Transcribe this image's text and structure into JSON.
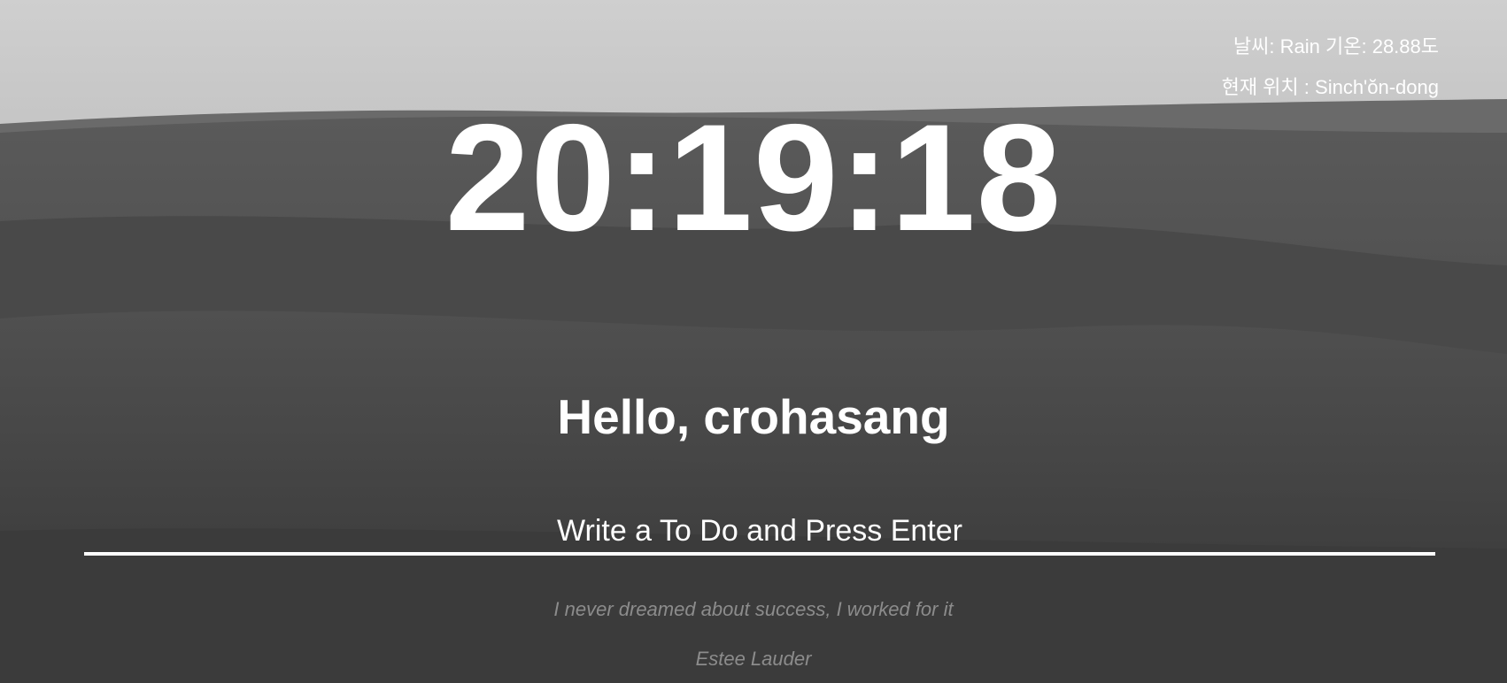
{
  "background": {
    "description_icon": "desert-dunes-image",
    "sky_color": "#cfcfcf",
    "dune_color": "#3d3d3d"
  },
  "weather": {
    "label": "날씨:",
    "condition": "Rain",
    "temp_label": "기온:",
    "temperature": "28.88도"
  },
  "location": {
    "label": "현재 위치 :",
    "name": "Sinch'ŏn-dong"
  },
  "clock": {
    "time": "20:19:18"
  },
  "greeting": {
    "text": "Hello, crohasang"
  },
  "todo": {
    "placeholder": "Write a To Do and Press Enter",
    "value": ""
  },
  "quote": {
    "text": "I never dreamed about success, I worked for it",
    "author": "Estee Lauder"
  }
}
